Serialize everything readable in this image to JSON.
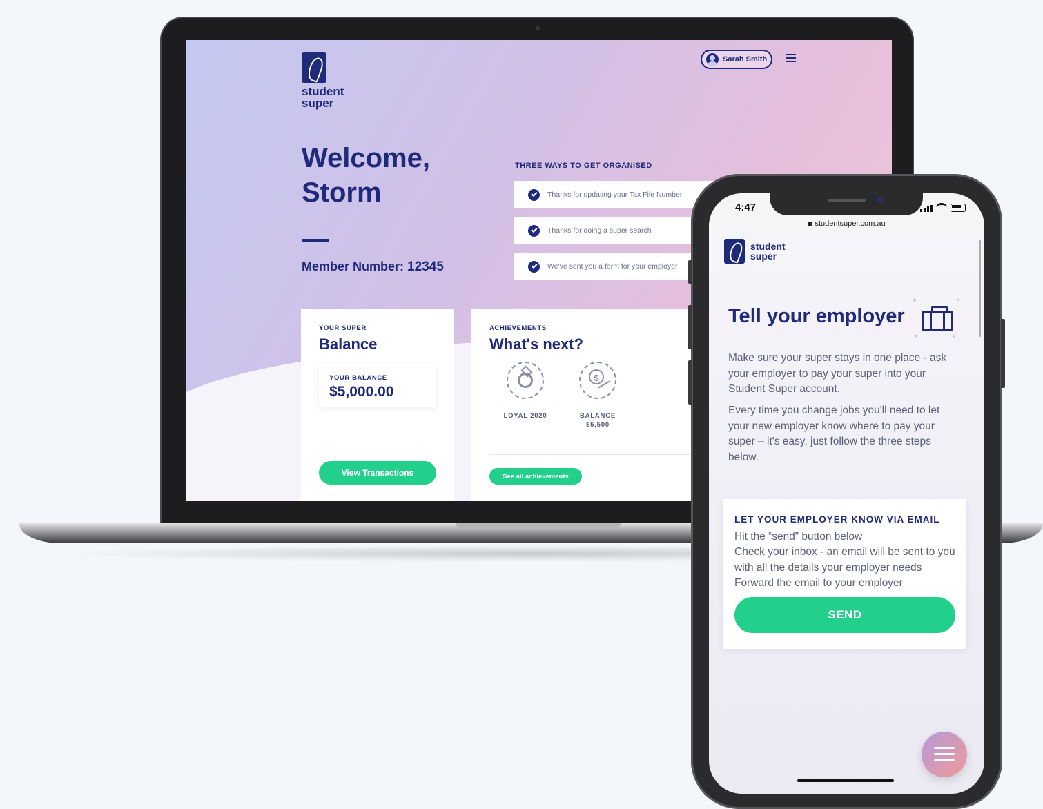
{
  "laptop": {
    "brand": {
      "line1": "student",
      "line2": "super"
    },
    "user": {
      "name": "Sarah Smith"
    },
    "welcome": {
      "line1": "Welcome,",
      "line2": "Storm"
    },
    "member": {
      "label": "Member Number:",
      "number": "12345"
    },
    "ways": {
      "title": "THREE WAYS TO GET ORGANISED",
      "items": [
        {
          "text": "Thanks for updating your Tax File Number"
        },
        {
          "text": "Thanks for doing a super search"
        },
        {
          "text": "We've sent you a form for your employer"
        }
      ]
    },
    "balance_card": {
      "eyebrow": "YOUR SUPER",
      "title": "Balance",
      "balance_label": "YOUR BALANCE",
      "balance_value": "$5,000.00",
      "button": "View Transactions"
    },
    "achievements_card": {
      "eyebrow": "ACHIEVEMENTS",
      "title": "What's next?",
      "items": [
        {
          "label": "LOYAL 2020",
          "icon": "ring-icon"
        },
        {
          "label": "BALANCE",
          "sublabel": "$5,500",
          "icon": "coin-icon"
        }
      ],
      "button": "See all achievements"
    }
  },
  "phone": {
    "status_bar": {
      "time": "4:47"
    },
    "url": "studentsuper.com.au",
    "brand": {
      "line1": "student",
      "line2": "super"
    },
    "title": "Tell your employer",
    "paragraph1": "Make sure your super stays in one place - ask your employer to pay your super into your Student Super account.",
    "paragraph2": "Every time you change jobs you'll need to let your new employer know where to pay your super – it's easy, just follow the three steps below.",
    "email_card": {
      "title": "LET YOUR EMPLOYER KNOW VIA EMAIL",
      "steps": [
        "Hit the “send” button below",
        "Check your inbox - an email will be sent to you with all the details your employer needs",
        "Forward the email to your employer"
      ],
      "button": "SEND"
    }
  },
  "colors": {
    "brand_navy": "#1f2a7a",
    "accent_green": "#22cf8b",
    "page_background": "#f3f6fb"
  }
}
